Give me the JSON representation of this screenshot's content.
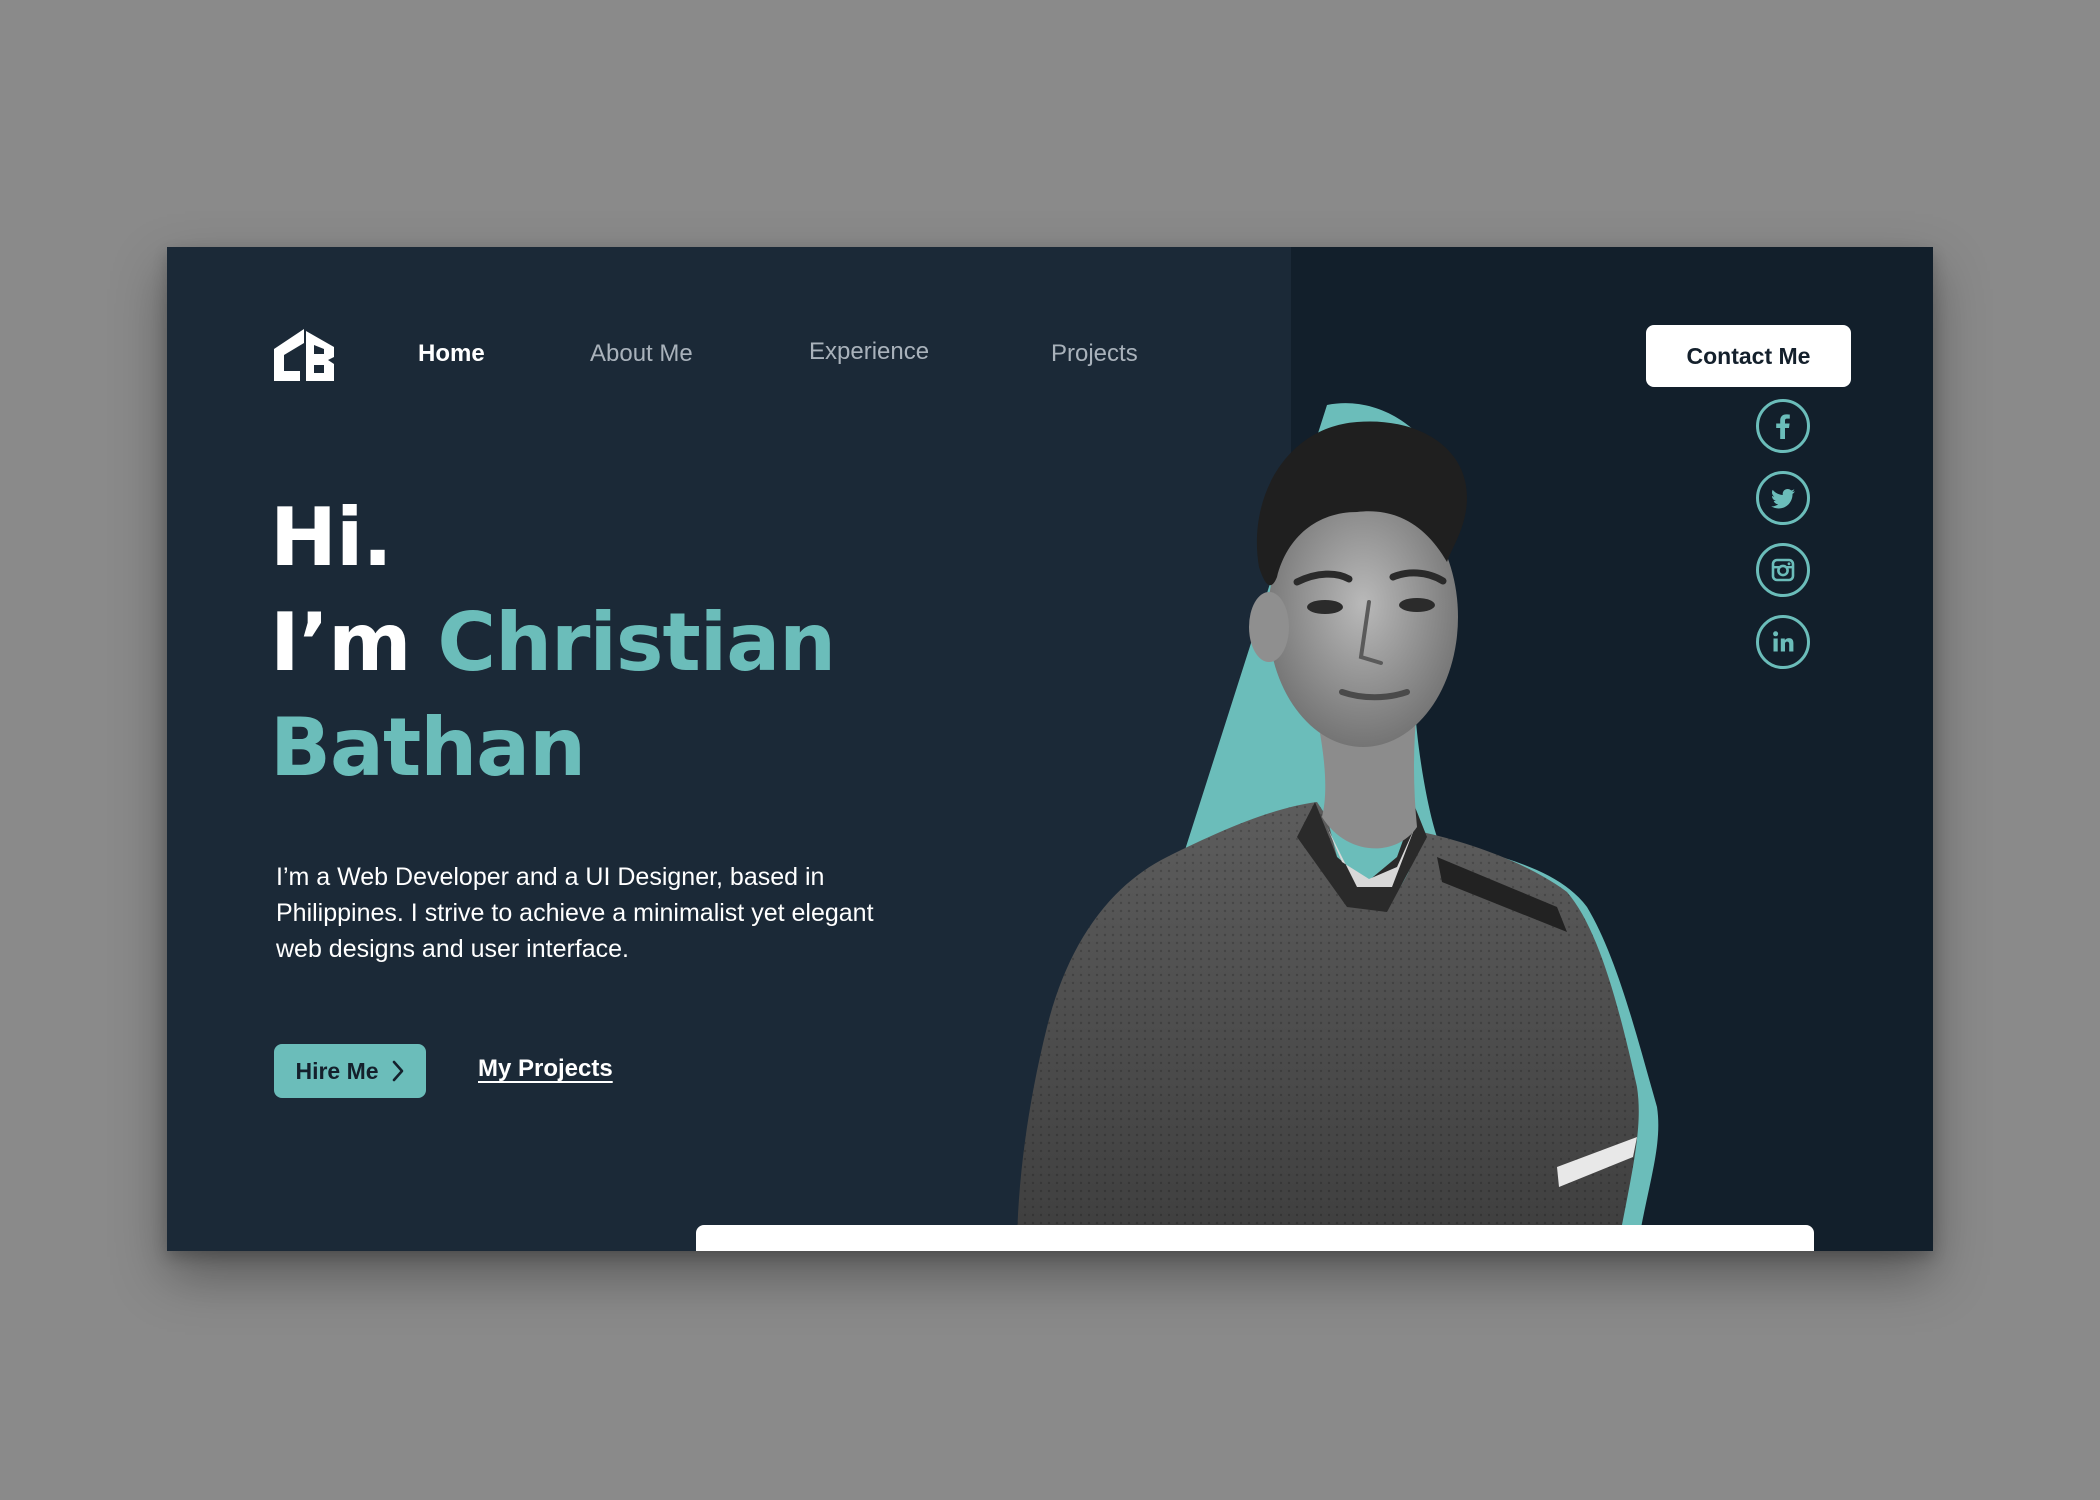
{
  "nav": {
    "logo_text": "CB",
    "links": [
      "Home",
      "About Me",
      "Experience",
      "Projects"
    ],
    "active": "Home",
    "contact_label": "Contact Me"
  },
  "hero": {
    "line1": "Hi.",
    "line2_prefix": "I’m ",
    "first_name": "Christian",
    "last_name": "Bathan",
    "description": "I’m a Web Developer and a UI Designer, based in Philippines. I strive to achieve a minimalist yet elegant web designs and user interface.",
    "hire_label": "Hire Me",
    "projects_label": "My Projects"
  },
  "socials": [
    "facebook-icon",
    "twitter-icon",
    "instagram-icon",
    "linkedin-icon"
  ],
  "colors": {
    "background": "#1b2937",
    "panel": "#121f2b",
    "accent": "#6bbdba",
    "text": "#ffffff",
    "muted": "#a9b2bb"
  }
}
